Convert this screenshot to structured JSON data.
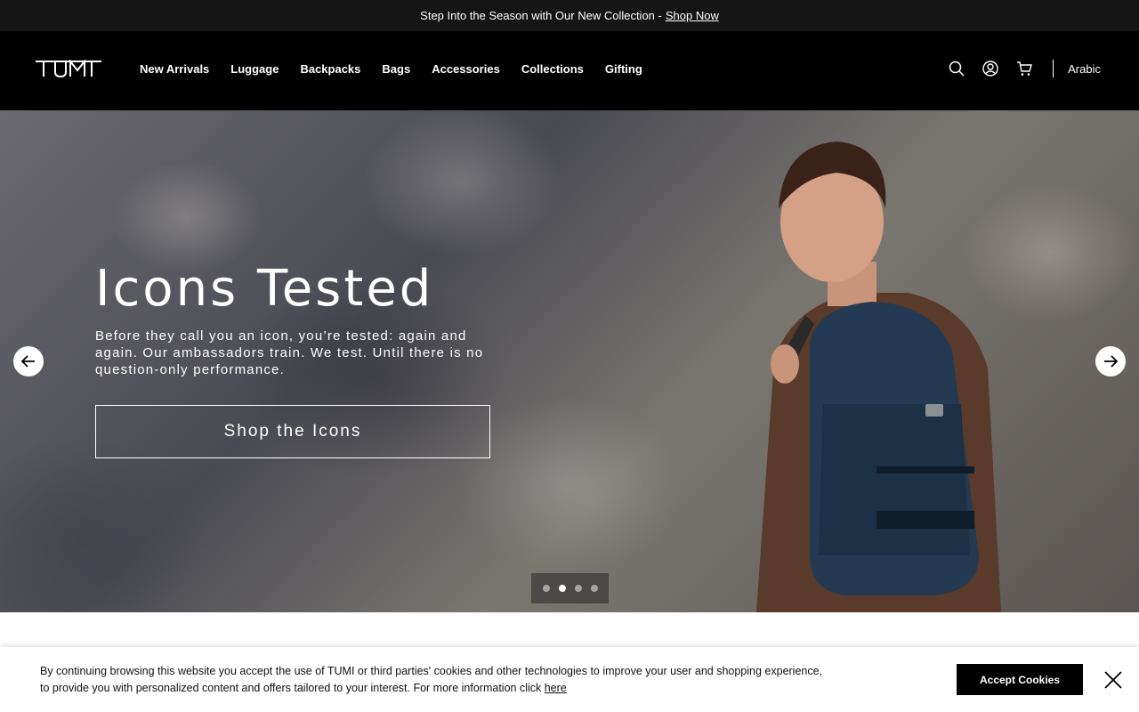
{
  "promo": {
    "text": "Step Into the Season with Our New Collection -",
    "link": "Shop Now"
  },
  "header": {
    "logo_icon": "tumi-logo",
    "nav": [
      "New Arrivals",
      "Luggage",
      "Backpacks",
      "Bags",
      "Accessories",
      "Collections",
      "Gifting"
    ],
    "icons": [
      "search-icon",
      "account-icon",
      "cart-icon"
    ],
    "language": "Arabic"
  },
  "hero": {
    "title": "Icons Tested",
    "subtitle": "Before they call you an icon, you’re tested: again and again. Our ambassadors train. We test. Until there is no question-only performance.",
    "cta": "Shop the Icons",
    "slide_count": 4,
    "active_slide": 2
  },
  "cookie": {
    "text_line1": "By continuing browsing this website you accept the use of TUMI or third parties' cookies and other technologies to improve your user and shopping experience,",
    "text_line2": "to provide you with personalized content and offers tailored to your interest. For more information click",
    "link": "here",
    "accept": "Accept Cookies"
  },
  "colors": {
    "promo_bg": "#151515",
    "header_bg": "#000000",
    "accept_bg": "#000000"
  }
}
